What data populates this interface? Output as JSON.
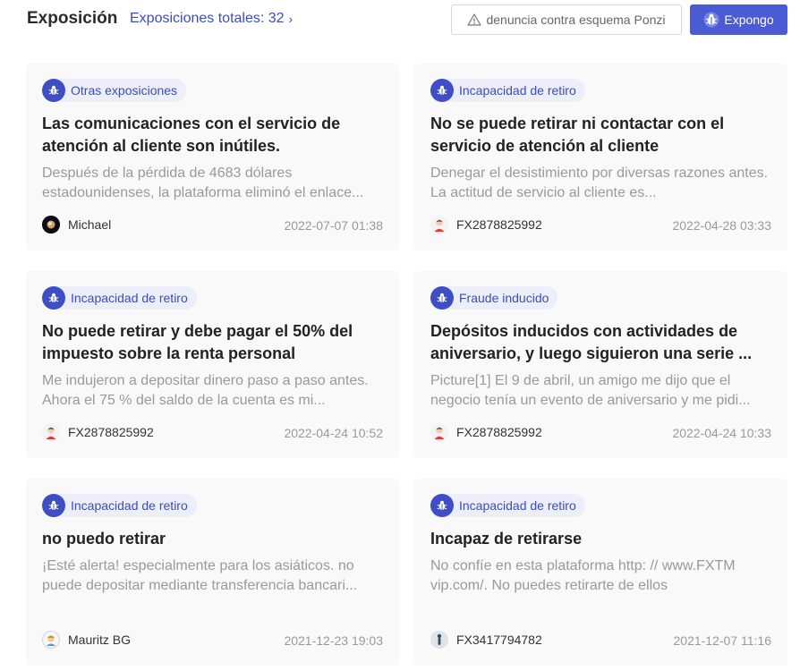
{
  "header": {
    "title": "Exposición",
    "total_label": "Exposiciones totales: 32",
    "ponzi_button": "denuncia contra esquema Ponzi",
    "expose_button": "Expongo"
  },
  "colors": {
    "accent": "#4a5bd4",
    "tag_bg": "#eceefa",
    "card_bg": "#f9f9fa"
  },
  "cards": [
    {
      "tag": "Otras exposiciones",
      "tag_icon": "bug-icon",
      "title": "Las comunicaciones con el servicio de atención al cliente son inútiles.",
      "excerpt": "Después de la pérdida de 4683 dólares estadounidenses, la plataforma eliminó el enlace...",
      "author": "Michael",
      "avatar": "planet-avatar",
      "date": "2022-07-07 01:38"
    },
    {
      "tag": "Incapacidad de retiro",
      "tag_icon": "bug-icon",
      "title": "No se puede retirar ni contactar con el servicio de atención al cliente",
      "excerpt": "Denegar el desistimiento por diversas razones antes. La actitud de servicio al cliente es...",
      "author": "FX2878825992",
      "avatar": "person-avatar",
      "date": "2022-04-28 03:33"
    },
    {
      "tag": "Incapacidad de retiro",
      "tag_icon": "bug-icon",
      "title": "No puede retirar y debe pagar el 50% del impuesto sobre la renta personal",
      "excerpt": "Me indujeron a depositar dinero paso a paso antes. Ahora el 75 % del saldo de la cuenta es mi...",
      "author": "FX2878825992",
      "avatar": "person-avatar",
      "date": "2022-04-24 10:52"
    },
    {
      "tag": "Fraude inducido",
      "tag_icon": "bug-icon",
      "title": "Depósitos inducidos con actividades de aniversario, y luego siguieron una serie ...",
      "excerpt": "Picture[1] El 9 de abril, un amigo me dijo que el negocio tenía un evento de aniversario y me pidi...",
      "author": "FX2878825992",
      "avatar": "person-avatar",
      "date": "2022-04-24 10:33"
    },
    {
      "tag": "Incapacidad de retiro",
      "tag_icon": "bug-icon",
      "title": "no puedo retirar",
      "excerpt": "¡Esté alerta! especialmente para los asiáticos. no puede depositar mediante transferencia bancari...",
      "author": "Mauritz BG",
      "avatar": "cartoon-avatar",
      "date": "2021-12-23 19:03"
    },
    {
      "tag": "Incapacidad de retiro",
      "tag_icon": "bug-icon",
      "title": "Incapaz de retirarse",
      "excerpt": "No confíe en esta plataforma http: // www.FXTM vip.com/. No puedes retirarte de ellos",
      "author": "FX3417794782",
      "avatar": "figure-avatar",
      "date": "2021-12-07 11:16"
    }
  ]
}
